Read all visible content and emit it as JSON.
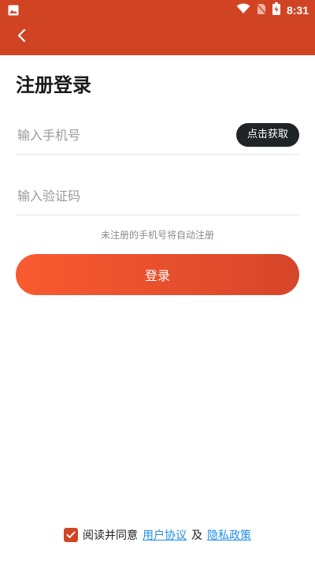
{
  "status_bar": {
    "time": "8:31"
  },
  "app_bar": {
    "back_icon": "chevron-left-icon"
  },
  "page": {
    "title": "注册登录"
  },
  "phone_field": {
    "placeholder": "输入手机号"
  },
  "get_code_button": {
    "label": "点击获取"
  },
  "code_field": {
    "placeholder": "输入验证码"
  },
  "hint": "未注册的手机号将自动注册",
  "login_button": {
    "label": "登录"
  },
  "agreement": {
    "checked": true,
    "prefix": "阅读并同意",
    "user_agreement_label": "用户协议",
    "and": "及",
    "privacy_policy_label": "隐私政策"
  },
  "colors": {
    "brand": "#d14423",
    "button_gradient_start": "#fa5a2f",
    "button_gradient_end": "#d6462a",
    "get_code_bg": "#1f2427",
    "link": "#1f8fe5"
  }
}
